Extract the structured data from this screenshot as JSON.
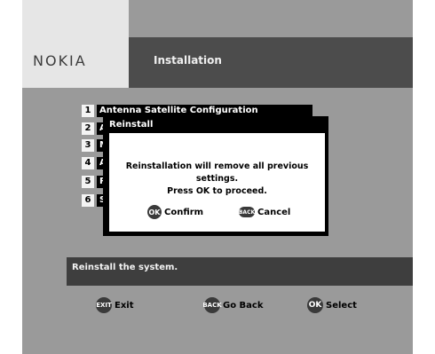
{
  "header": {
    "brand": "NOKIA",
    "title": "Installation"
  },
  "menu": {
    "items": [
      {
        "number": "1",
        "label": "Antenna Satellite Configuration"
      },
      {
        "number": "2",
        "label": "A"
      },
      {
        "number": "3",
        "label": "M"
      },
      {
        "number": "4",
        "label": "A"
      },
      {
        "number": "5",
        "label": "R"
      },
      {
        "number": "6",
        "label": "S"
      }
    ]
  },
  "dialog": {
    "title": "Reinstall",
    "message_line1": "Reinstallation will remove all previous settings.",
    "message_line2": "Press OK to proceed.",
    "confirm": {
      "key": "OK",
      "label": "Confirm"
    },
    "cancel": {
      "key": "BACK",
      "label": "Cancel"
    }
  },
  "status": {
    "text": "Reinstall the system."
  },
  "footer": {
    "exit": {
      "key": "EXIT",
      "label": "Exit"
    },
    "back": {
      "key": "BACK",
      "label": "Go Back"
    },
    "select": {
      "key": "OK",
      "label": "Select"
    }
  },
  "colors": {
    "background": "#9a9a9a",
    "header_dark": "#4c4c4c",
    "logo_bg": "#e6e6e6",
    "status_bg": "#3e3e3e",
    "button_badge": "#3a3a3a"
  }
}
